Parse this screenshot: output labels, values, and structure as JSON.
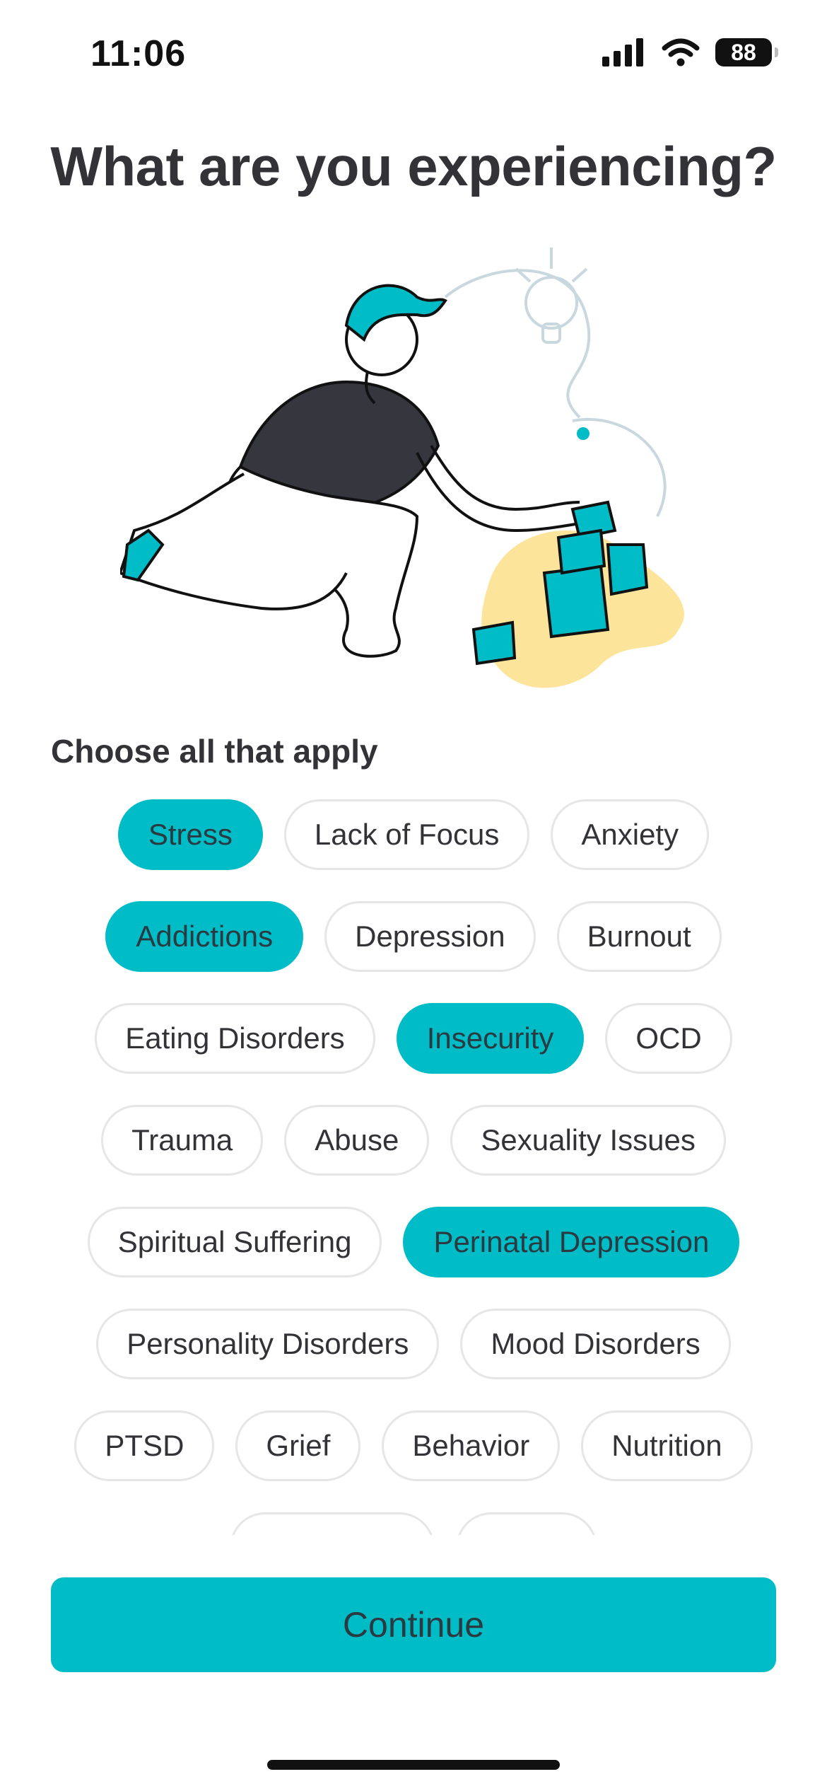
{
  "status": {
    "time": "11:06",
    "battery": "88"
  },
  "title": "What are you experiencing?",
  "section_label": "Choose all that apply",
  "accent_color": "#00bcc7",
  "chip_rows": [
    [
      {
        "label": "Stress",
        "selected": true
      },
      {
        "label": "Lack of Focus",
        "selected": false
      },
      {
        "label": "Anxiety",
        "selected": false
      }
    ],
    [
      {
        "label": "Addictions",
        "selected": true
      },
      {
        "label": "Depression",
        "selected": false
      },
      {
        "label": "Burnout",
        "selected": false
      }
    ],
    [
      {
        "label": "Eating Disorders",
        "selected": false
      },
      {
        "label": "Insecurity",
        "selected": true
      },
      {
        "label": "OCD",
        "selected": false
      }
    ],
    [
      {
        "label": "Trauma",
        "selected": false
      },
      {
        "label": "Abuse",
        "selected": false
      },
      {
        "label": "Sexuality Issues",
        "selected": false
      }
    ],
    [
      {
        "label": "Spiritual Suffering",
        "selected": false
      },
      {
        "label": "Perinatal Depression",
        "selected": true
      }
    ],
    [
      {
        "label": "Personality Disorders",
        "selected": false
      },
      {
        "label": "Mood Disorders",
        "selected": false
      }
    ],
    [
      {
        "label": "PTSD",
        "selected": false
      },
      {
        "label": "Grief",
        "selected": false
      },
      {
        "label": "Behavior",
        "selected": false
      },
      {
        "label": "Nutrition",
        "selected": false
      }
    ],
    [
      {
        "label": "",
        "selected": false
      },
      {
        "label": "",
        "selected": false
      }
    ]
  ],
  "continue_label": "Continue",
  "icons": {
    "signal": "cellular-signal-icon",
    "wifi": "wifi-icon",
    "battery": "battery-icon",
    "hero": "person-building-blocks-illustration"
  }
}
